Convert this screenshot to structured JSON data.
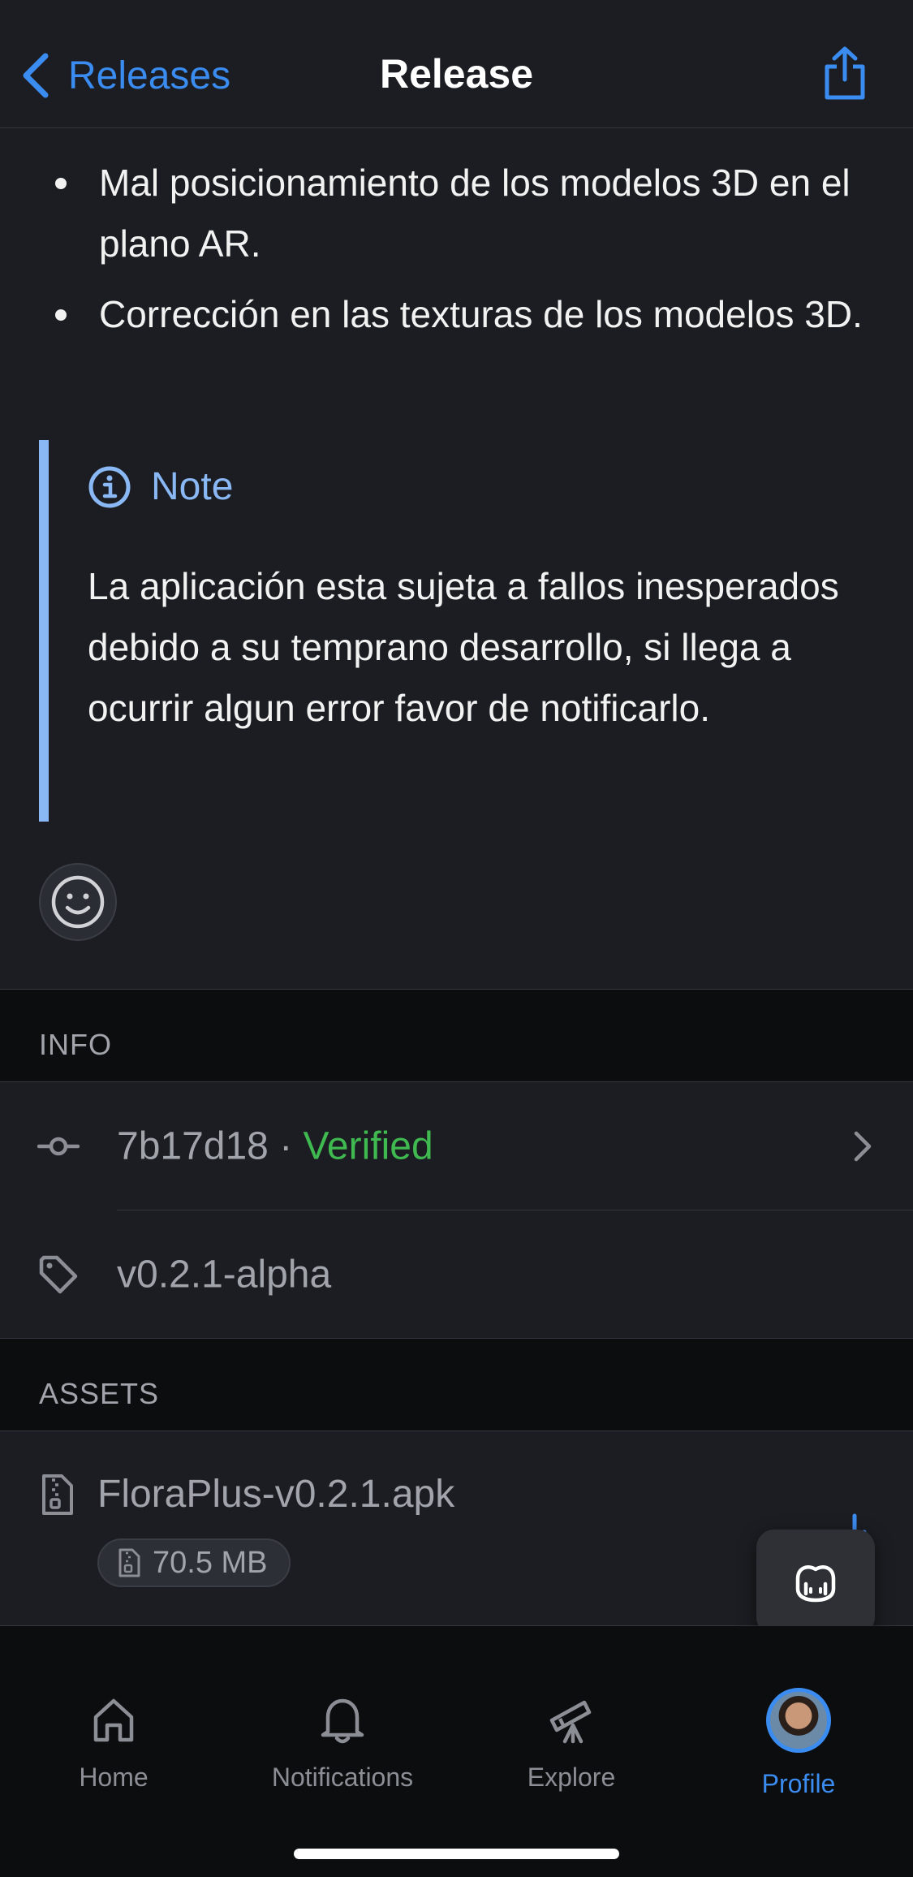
{
  "nav": {
    "back_label": "Releases",
    "title": "Release"
  },
  "notes": {
    "bullets": [
      "Mal posicionamiento de los modelos 3D en el plano AR.",
      "Corrección en las texturas de los modelos 3D."
    ],
    "note_title": "Note",
    "note_text": "La aplicación esta sujeta a fallos inesperados debido a su temprano desarrollo, si llega a ocurrir algun error favor de notificarlo."
  },
  "info": {
    "header": "INFO",
    "commit": "7b17d18",
    "separator": " · ",
    "verified": "Verified",
    "tag": "v0.2.1-alpha"
  },
  "assets": {
    "header": "ASSETS",
    "file_name": "FloraPlus-v0.2.1.apk",
    "file_size": "70.5 MB"
  },
  "tabs": [
    {
      "label": "Home",
      "icon": "home-icon"
    },
    {
      "label": "Notifications",
      "icon": "bell-icon"
    },
    {
      "label": "Explore",
      "icon": "telescope-icon"
    },
    {
      "label": "Profile",
      "icon": "avatar",
      "active": true
    }
  ],
  "colors": {
    "accent": "#3b8cf0",
    "verified": "#3fb950",
    "note": "#8ab8f5",
    "background": "#1b1d22"
  }
}
